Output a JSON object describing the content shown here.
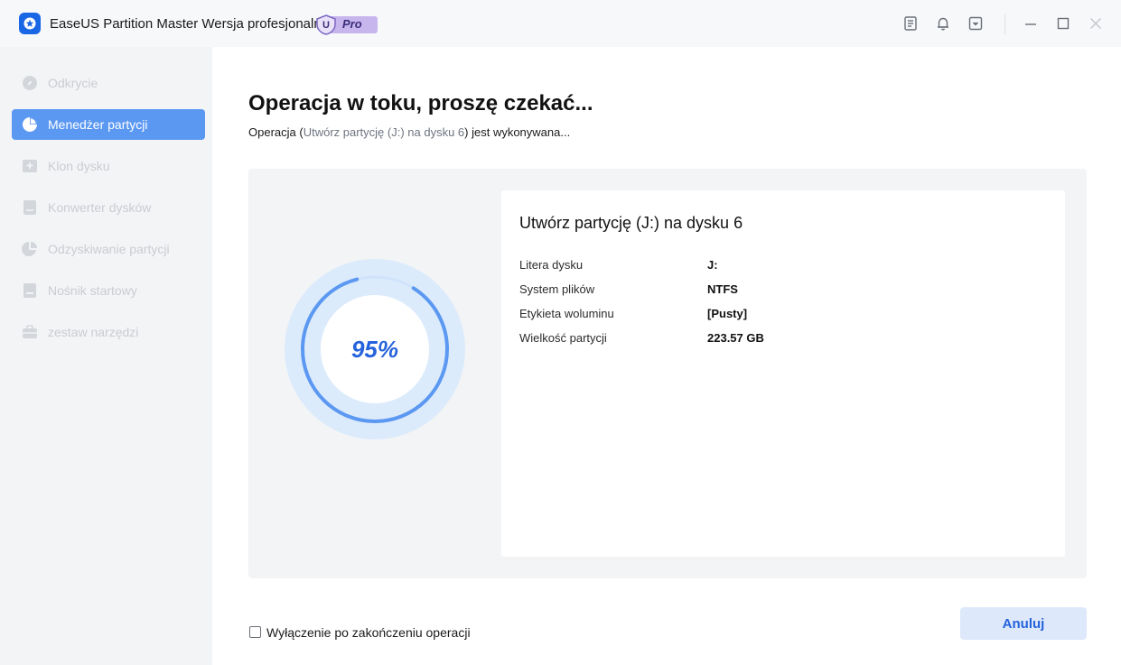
{
  "titlebar": {
    "app_title": "EaseUS Partition Master Wersja profesjonalna",
    "badge_letter": "U",
    "badge_text": "Pro"
  },
  "sidebar": {
    "items": [
      {
        "label": "Odkrycie",
        "icon": "compass-icon",
        "active": false
      },
      {
        "label": "Menedżer partycji",
        "icon": "pie-chart-icon",
        "active": true
      },
      {
        "label": "Klon dysku",
        "icon": "clone-icon",
        "active": false
      },
      {
        "label": "Konwerter dysków",
        "icon": "disk-convert-icon",
        "active": false
      },
      {
        "label": "Odzyskiwanie partycji",
        "icon": "partition-recovery-icon",
        "active": false
      },
      {
        "label": "Nośnik startowy",
        "icon": "bootable-media-icon",
        "active": false
      },
      {
        "label": "zestaw narzędzi",
        "icon": "toolbox-icon",
        "active": false
      }
    ]
  },
  "main": {
    "heading": "Operacja w toku, proszę czekać...",
    "subline_prefix": "Operacja (",
    "subline_highlight": "Utwórz partycję (J:) na dysku 6",
    "subline_suffix": ") jest wykonywana...",
    "progress": {
      "percent": 95,
      "label": "95%"
    },
    "card": {
      "title": "Utwórz partycję (J:) na dysku 6",
      "properties": [
        {
          "label": "Litera dysku",
          "value": "J:"
        },
        {
          "label": "System plików",
          "value": "NTFS"
        },
        {
          "label": "Etykieta woluminu",
          "value": "[Pusty]"
        },
        {
          "label": "Wielkość partycji",
          "value": "223.57 GB"
        }
      ]
    },
    "shutdown_label": "Wyłączenie po zakończeniu operacji",
    "cancel_label": "Anuluj"
  },
  "colors": {
    "accent": "#2563dc",
    "active_nav": "#5b98f2",
    "ring_bg": "#dcebfb"
  }
}
